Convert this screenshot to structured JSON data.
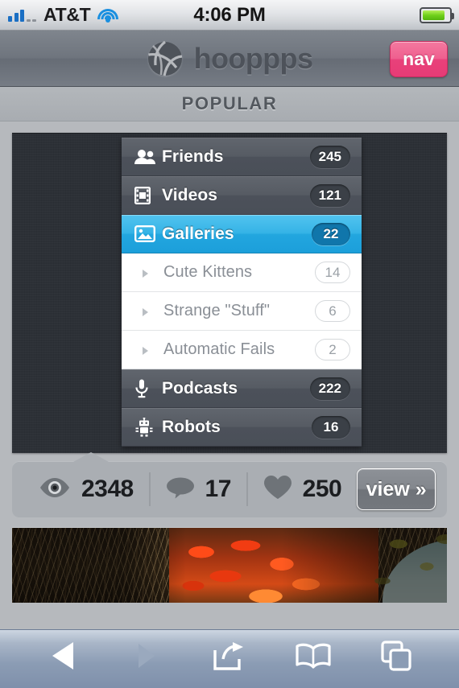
{
  "status_bar": {
    "carrier": "AT&T",
    "time": "4:06 PM",
    "signal_bars_filled": 3,
    "signal_bars_total": 5,
    "wifi": "wifi-icon",
    "battery_percent": 84
  },
  "app_header": {
    "logo_icon": "basketball-logo-icon",
    "brand": "hooppps",
    "nav_label": "nav",
    "nav_color": "#ef5f8f"
  },
  "section": {
    "title": "POPULAR"
  },
  "screenshot": {
    "accent_color": "#29abe2",
    "menu": [
      {
        "icon": "friends-icon",
        "label": "Friends",
        "badge": "245",
        "type": "primary"
      },
      {
        "icon": "video-icon",
        "label": "Videos",
        "badge": "121",
        "type": "primary"
      },
      {
        "icon": "gallery-icon",
        "label": "Galleries",
        "badge": "22",
        "type": "active"
      },
      {
        "icon": "chevron-right-icon",
        "label": "Cute Kittens",
        "badge": "14",
        "type": "sub"
      },
      {
        "icon": "chevron-right-icon",
        "label": "Strange \"Stuff\"",
        "badge": "6",
        "type": "sub"
      },
      {
        "icon": "chevron-right-icon",
        "label": "Automatic Fails",
        "badge": "2",
        "type": "sub"
      },
      {
        "icon": "microphone-icon",
        "label": "Podcasts",
        "badge": "222",
        "type": "primary"
      },
      {
        "icon": "robot-icon",
        "label": "Robots",
        "badge": "16",
        "type": "primary"
      }
    ]
  },
  "stats": {
    "views_icon": "eye-icon",
    "views": "2348",
    "comments_icon": "comment-bubble-icon",
    "comments": "17",
    "likes_icon": "heart-icon",
    "likes": "250",
    "view_button": "view »"
  },
  "next_photo": {
    "alt": "autumn-leaves-photo"
  },
  "toolbar": {
    "items": [
      {
        "icon": "back-arrow-icon",
        "label": "Back",
        "enabled": true
      },
      {
        "icon": "forward-arrow-icon",
        "label": "Forward",
        "enabled": false
      },
      {
        "icon": "share-icon",
        "label": "Share",
        "enabled": true
      },
      {
        "icon": "bookmarks-icon",
        "label": "Bookmarks",
        "enabled": true
      },
      {
        "icon": "tabs-icon",
        "label": "Tabs",
        "enabled": true
      }
    ]
  }
}
